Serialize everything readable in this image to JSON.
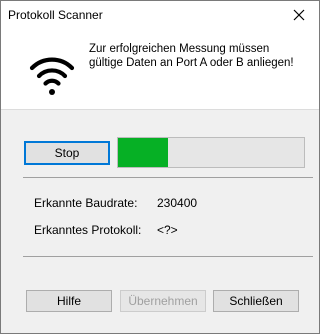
{
  "window": {
    "title": "Protokoll Scanner",
    "close_icon": "close-icon"
  },
  "header": {
    "icon": "wifi-icon",
    "message_line1": "Zur erfolgreichen Messung müssen",
    "message_line2": "gültige Daten an Port A oder B anliegen!"
  },
  "controls": {
    "stop_label": "Stop",
    "progress_fraction": 0.27,
    "progress_color": "#06b025"
  },
  "info": {
    "baudrate_label": "Erkannte Baudrate:",
    "baudrate_value": "230400",
    "protocol_label": "Erkanntes Protokoll:",
    "protocol_value": "<?>"
  },
  "footer": {
    "help_label": "Hilfe",
    "apply_label": "Übernehmen",
    "apply_enabled": false,
    "close_label": "Schließen"
  },
  "colors": {
    "focus_border": "#0078d7",
    "dialog_bg": "#f0f0f0"
  }
}
